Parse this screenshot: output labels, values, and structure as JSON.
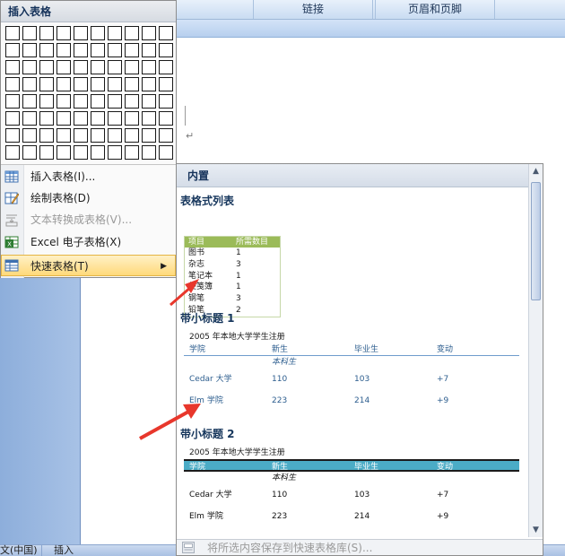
{
  "ribbon": {
    "links_label": "链接",
    "header_footer_label": "页眉和页脚"
  },
  "status_bar": {
    "language": "文(中国)",
    "insert_mode": "插入"
  },
  "insert_menu": {
    "title": "插入表格",
    "grid_rows": 8,
    "grid_cols": 10,
    "items": [
      {
        "label": "插入表格(I)...",
        "icon": "insert-table-icon",
        "enabled": true
      },
      {
        "label": "绘制表格(D)",
        "icon": "draw-table-icon",
        "enabled": true
      },
      {
        "label": "文本转换成表格(V)...",
        "icon": "text-to-table-icon",
        "enabled": false
      },
      {
        "label": "Excel 电子表格(X)",
        "icon": "excel-icon",
        "enabled": true
      },
      {
        "label": "快速表格(T)",
        "icon": "quick-table-icon",
        "enabled": true,
        "highlighted": true
      }
    ]
  },
  "gallery": {
    "header": "内置",
    "sections": {
      "tabular_list": {
        "title": "表格式列表",
        "columns": [
          "项目",
          "所需数目"
        ],
        "rows": [
          [
            "图书",
            "1"
          ],
          [
            "杂志",
            "3"
          ],
          [
            "笔记本",
            "1"
          ],
          [
            "便笺簿",
            "1"
          ],
          [
            "钢笔",
            "3"
          ],
          [
            "铅笔",
            "2"
          ]
        ]
      },
      "subheading1": {
        "title": "带小标题 1",
        "caption": "2005 年本地大学学生注册",
        "columns": [
          "学院",
          "新生",
          "毕业生",
          "变动"
        ],
        "section_label": "本科生",
        "rows": [
          [
            "Cedar 大学",
            "110",
            "103",
            "+7"
          ],
          [
            "Elm 学院",
            "223",
            "214",
            "+9"
          ]
        ]
      },
      "subheading2": {
        "title": "带小标题 2",
        "caption": "2005 年本地大学学生注册",
        "columns": [
          "学院",
          "新生",
          "毕业生",
          "变动"
        ],
        "section_label": "本科生",
        "rows": [
          [
            "Cedar 大学",
            "110",
            "103",
            "+7"
          ],
          [
            "Elm 学院",
            "223",
            "214",
            "+9"
          ]
        ]
      }
    },
    "footer_label": "将所选内容保存到快速表格库(S)..."
  },
  "colors": {
    "tabular_header": "#9bbb59",
    "subheading2_header": "#4bacc6",
    "menu_highlight": "#ffd97a",
    "annotation_arrow": "#e8372c"
  }
}
